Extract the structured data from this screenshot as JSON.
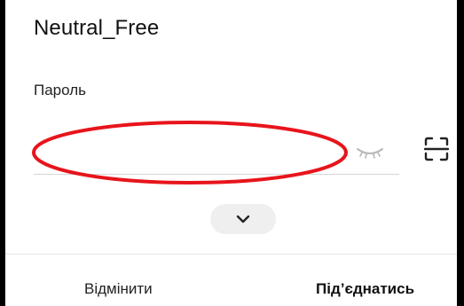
{
  "dialog": {
    "network_name": "Neutral_Free",
    "password_label": "Пароль",
    "password_value": "",
    "password_placeholder": ""
  },
  "icons": {
    "visibility_toggle": "eye-closed-icon",
    "scan": "qr-scan-icon",
    "expand": "chevron-down-icon"
  },
  "actions": {
    "cancel_label": "Відмінити",
    "connect_label": "Під’єднатись"
  },
  "colors": {
    "annotation": "#e8141b",
    "background": "#ffffff"
  }
}
